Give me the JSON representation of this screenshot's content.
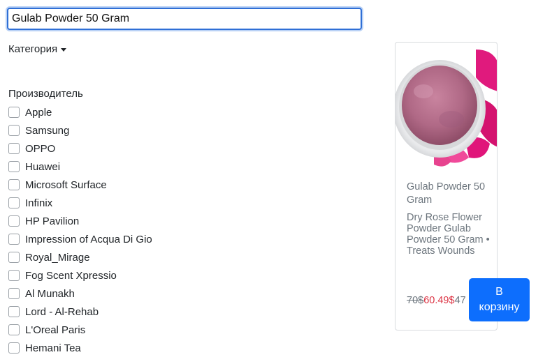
{
  "search": {
    "value": "Gulab Powder 50 Gram"
  },
  "filters": {
    "category_label": "Категория",
    "manufacturer_label": "Производитель",
    "brands": [
      "Apple",
      "Samsung",
      "OPPO",
      "Huawei",
      "Microsoft Surface",
      "Infinix",
      "HP Pavilion",
      "Impression of Acqua Di Gio",
      "Royal_Mirage",
      "Fog Scent Xpressio",
      "Al Munakh",
      "Lord - Al-Rehab",
      "L'Oreal Paris",
      "Hemani Tea"
    ]
  },
  "product": {
    "title": "Gulab Powder 50 Gram",
    "description": "Dry Rose Flower Powder Gulab Powder 50 Gram • Treats Wounds",
    "old_price": "70$",
    "new_price": "60.49$",
    "extra_price": "47",
    "cart_button_label": "В корзину"
  },
  "colors": {
    "primary": "#0d6efd",
    "sale": "#dc3545",
    "muted": "#6c757d"
  }
}
